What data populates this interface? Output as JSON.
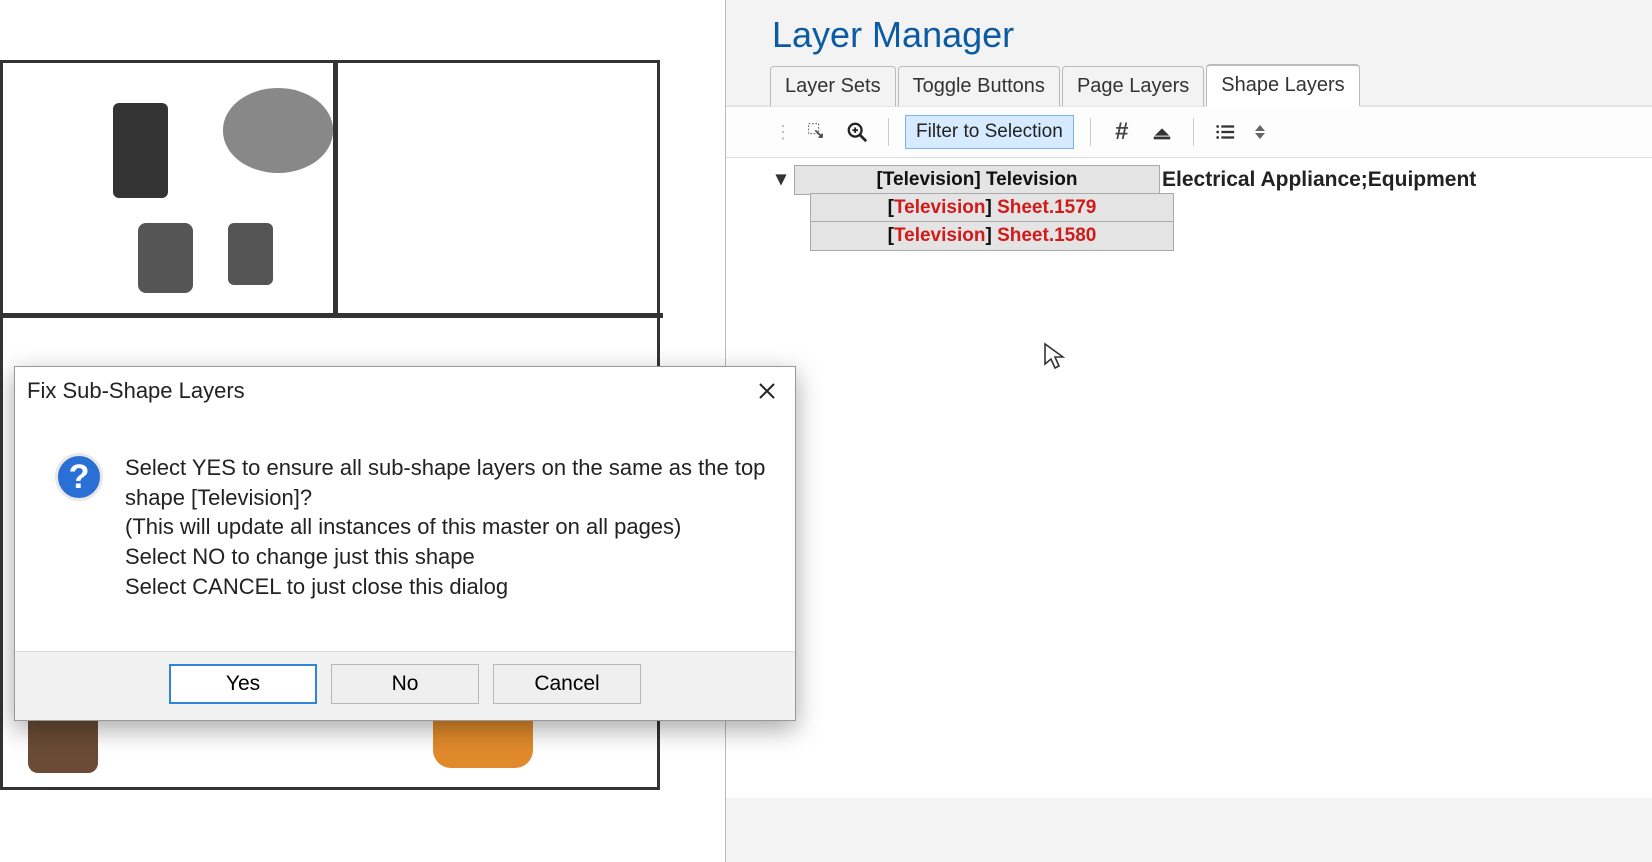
{
  "panel": {
    "title": "Layer Manager",
    "tabs": [
      "Layer Sets",
      "Toggle Buttons",
      "Page Layers",
      "Shape Layers"
    ],
    "active_tab_index": 3
  },
  "toolbar": {
    "filter_label": "Filter to Selection"
  },
  "tree": {
    "root": {
      "prefix": "[",
      "master": "Television",
      "suffix": "] Television",
      "category": "Electrical Appliance;Equipment",
      "children": [
        {
          "prefix": "[",
          "master": "Television",
          "mid": "] ",
          "sheet": "Sheet.1579"
        },
        {
          "prefix": "[",
          "master": "Television",
          "mid": "] ",
          "sheet": "Sheet.1580"
        }
      ]
    }
  },
  "dialog": {
    "title": "Fix Sub-Shape Layers",
    "line1": "Select YES to ensure all sub-shape layers on the same as the top shape [Television]?",
    "line2": "(This will update all instances of this master on all pages)",
    "line3": "Select NO to change just this shape",
    "line4": "Select CANCEL to just close this dialog",
    "yes": "Yes",
    "no": "No",
    "cancel": "Cancel"
  }
}
